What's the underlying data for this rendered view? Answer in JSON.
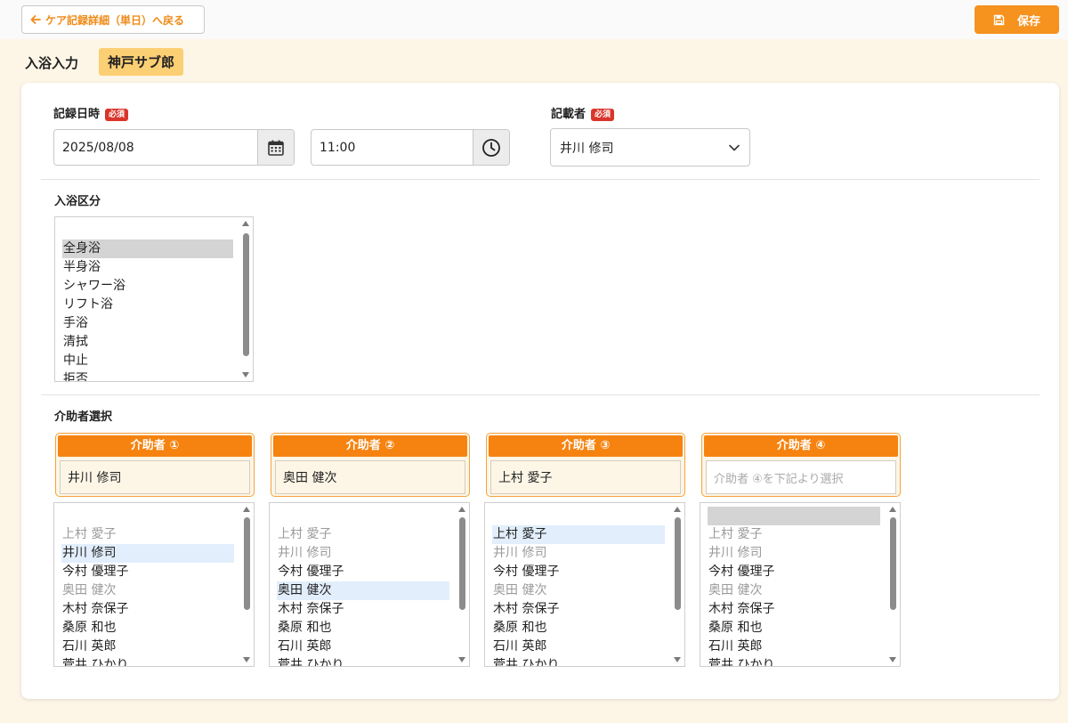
{
  "header": {
    "back_label": "ケア記録詳細（単日）へ戻る",
    "save_label": "保存"
  },
  "page": {
    "title": "入浴入力",
    "resident_name": "神戸サブ郎"
  },
  "form": {
    "record_datetime_label": "記録日時",
    "required_badge": "必須",
    "date_value": "2025/08/08",
    "time_value": "11:00",
    "recorder_label": "記載者",
    "recorder_value": "井川 修司",
    "bath_type_label": "入浴区分",
    "bath_type_options": [
      "全身浴",
      "半身浴",
      "シャワー浴",
      "リフト浴",
      "手浴",
      "清拭",
      "中止",
      "拒否"
    ],
    "bath_type_selected": "全身浴",
    "helper_section_label": "介助者選択"
  },
  "helpers": [
    {
      "title": "介助者 ①",
      "value": "井川 修司",
      "placeholder": "",
      "list": [
        {
          "name": "上村 愛子",
          "state": "muted"
        },
        {
          "name": "井川 修司",
          "state": "selected"
        },
        {
          "name": "今村 優理子",
          "state": "normal"
        },
        {
          "name": "奥田 健次",
          "state": "muted"
        },
        {
          "name": "木村 奈保子",
          "state": "normal"
        },
        {
          "name": "桑原 和也",
          "state": "normal"
        },
        {
          "name": "石川 英郎",
          "state": "normal"
        },
        {
          "name": "菅井 ひかり",
          "state": "normal"
        }
      ]
    },
    {
      "title": "介助者 ②",
      "value": "奥田 健次",
      "placeholder": "",
      "list": [
        {
          "name": "上村 愛子",
          "state": "muted"
        },
        {
          "name": "井川 修司",
          "state": "muted"
        },
        {
          "name": "今村 優理子",
          "state": "normal"
        },
        {
          "name": "奥田 健次",
          "state": "selected"
        },
        {
          "name": "木村 奈保子",
          "state": "normal"
        },
        {
          "name": "桑原 和也",
          "state": "normal"
        },
        {
          "name": "石川 英郎",
          "state": "normal"
        },
        {
          "name": "菅井 ひかり",
          "state": "normal"
        }
      ]
    },
    {
      "title": "介助者 ③",
      "value": "上村 愛子",
      "placeholder": "",
      "list": [
        {
          "name": "上村 愛子",
          "state": "selected"
        },
        {
          "name": "井川 修司",
          "state": "muted"
        },
        {
          "name": "今村 優理子",
          "state": "normal"
        },
        {
          "name": "奥田 健次",
          "state": "muted"
        },
        {
          "name": "木村 奈保子",
          "state": "normal"
        },
        {
          "name": "桑原 和也",
          "state": "normal"
        },
        {
          "name": "石川 英郎",
          "state": "normal"
        },
        {
          "name": "菅井 ひかり",
          "state": "normal"
        }
      ]
    },
    {
      "title": "介助者 ④",
      "value": "",
      "placeholder": "介助者 ④を下記より選択",
      "list": [
        {
          "name": "上村 愛子",
          "state": "muted"
        },
        {
          "name": "井川 修司",
          "state": "muted"
        },
        {
          "name": "今村 優理子",
          "state": "normal"
        },
        {
          "name": "奥田 健次",
          "state": "muted"
        },
        {
          "name": "木村 奈保子",
          "state": "normal"
        },
        {
          "name": "桑原 和也",
          "state": "normal"
        },
        {
          "name": "石川 英郎",
          "state": "normal"
        },
        {
          "name": "菅井 ひかり",
          "state": "normal"
        }
      ]
    }
  ],
  "colors": {
    "accent": "#f6830f",
    "required": "#d9352b",
    "background": "#fdf6e7",
    "badge": "#fbcf73"
  }
}
